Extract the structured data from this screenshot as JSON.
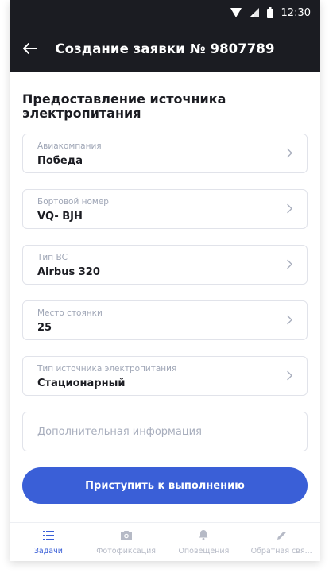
{
  "status_bar": {
    "time": "12:30"
  },
  "app_bar": {
    "title": "Создание заявки № 9807789"
  },
  "section": {
    "title": "Предоставление источника электропитания"
  },
  "fields": [
    {
      "label": "Авиакомпания",
      "value": "Победа"
    },
    {
      "label": "Бортовой номер",
      "value": "VQ- BJH"
    },
    {
      "label": "Тип ВС",
      "value": "Airbus 320"
    },
    {
      "label": "Место стоянки",
      "value": "25"
    },
    {
      "label": "Тип источника электропитания",
      "value": "Стационарный"
    }
  ],
  "additional_info": {
    "placeholder": "Дополнительная информация"
  },
  "primary_button": {
    "label": "Приступить к выполнению"
  },
  "bottom_nav": [
    {
      "label": "Задачи",
      "icon": "list-icon",
      "active": true
    },
    {
      "label": "Фотофиксация",
      "icon": "camera-icon",
      "active": false
    },
    {
      "label": "Оповещения",
      "icon": "bell-icon",
      "active": false
    },
    {
      "label": "Обратная свя...",
      "icon": "pencil-icon",
      "active": false
    }
  ],
  "colors": {
    "header": "#1b1c22",
    "accent": "#3a5fd7",
    "muted": "#9fa6b6"
  }
}
